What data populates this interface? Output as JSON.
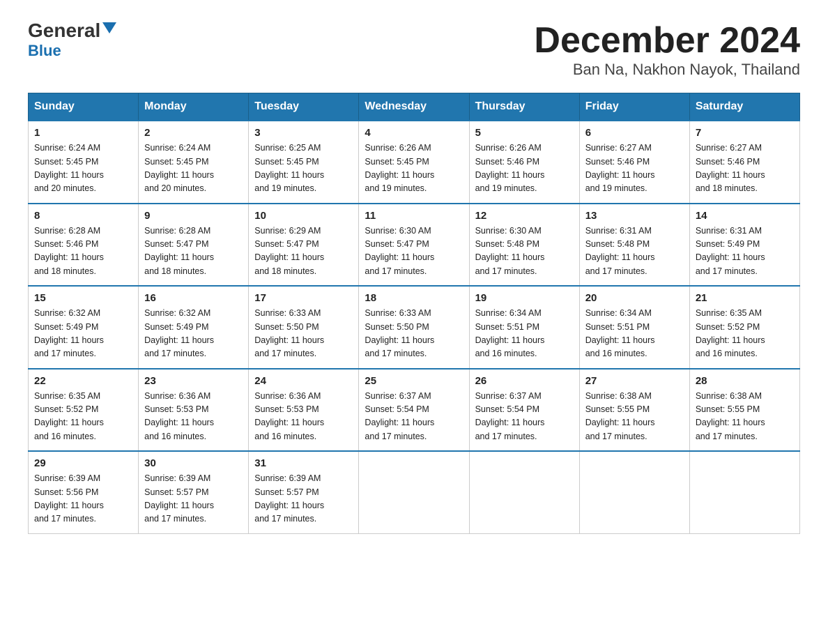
{
  "header": {
    "logo_general": "General",
    "logo_blue": "Blue",
    "month_title": "December 2024",
    "location": "Ban Na, Nakhon Nayok, Thailand"
  },
  "weekdays": [
    "Sunday",
    "Monday",
    "Tuesday",
    "Wednesday",
    "Thursday",
    "Friday",
    "Saturday"
  ],
  "weeks": [
    [
      {
        "day": "1",
        "sunrise": "6:24 AM",
        "sunset": "5:45 PM",
        "daylight": "11 hours and 20 minutes."
      },
      {
        "day": "2",
        "sunrise": "6:24 AM",
        "sunset": "5:45 PM",
        "daylight": "11 hours and 20 minutes."
      },
      {
        "day": "3",
        "sunrise": "6:25 AM",
        "sunset": "5:45 PM",
        "daylight": "11 hours and 19 minutes."
      },
      {
        "day": "4",
        "sunrise": "6:26 AM",
        "sunset": "5:45 PM",
        "daylight": "11 hours and 19 minutes."
      },
      {
        "day": "5",
        "sunrise": "6:26 AM",
        "sunset": "5:46 PM",
        "daylight": "11 hours and 19 minutes."
      },
      {
        "day": "6",
        "sunrise": "6:27 AM",
        "sunset": "5:46 PM",
        "daylight": "11 hours and 19 minutes."
      },
      {
        "day": "7",
        "sunrise": "6:27 AM",
        "sunset": "5:46 PM",
        "daylight": "11 hours and 18 minutes."
      }
    ],
    [
      {
        "day": "8",
        "sunrise": "6:28 AM",
        "sunset": "5:46 PM",
        "daylight": "11 hours and 18 minutes."
      },
      {
        "day": "9",
        "sunrise": "6:28 AM",
        "sunset": "5:47 PM",
        "daylight": "11 hours and 18 minutes."
      },
      {
        "day": "10",
        "sunrise": "6:29 AM",
        "sunset": "5:47 PM",
        "daylight": "11 hours and 18 minutes."
      },
      {
        "day": "11",
        "sunrise": "6:30 AM",
        "sunset": "5:47 PM",
        "daylight": "11 hours and 17 minutes."
      },
      {
        "day": "12",
        "sunrise": "6:30 AM",
        "sunset": "5:48 PM",
        "daylight": "11 hours and 17 minutes."
      },
      {
        "day": "13",
        "sunrise": "6:31 AM",
        "sunset": "5:48 PM",
        "daylight": "11 hours and 17 minutes."
      },
      {
        "day": "14",
        "sunrise": "6:31 AM",
        "sunset": "5:49 PM",
        "daylight": "11 hours and 17 minutes."
      }
    ],
    [
      {
        "day": "15",
        "sunrise": "6:32 AM",
        "sunset": "5:49 PM",
        "daylight": "11 hours and 17 minutes."
      },
      {
        "day": "16",
        "sunrise": "6:32 AM",
        "sunset": "5:49 PM",
        "daylight": "11 hours and 17 minutes."
      },
      {
        "day": "17",
        "sunrise": "6:33 AM",
        "sunset": "5:50 PM",
        "daylight": "11 hours and 17 minutes."
      },
      {
        "day": "18",
        "sunrise": "6:33 AM",
        "sunset": "5:50 PM",
        "daylight": "11 hours and 17 minutes."
      },
      {
        "day": "19",
        "sunrise": "6:34 AM",
        "sunset": "5:51 PM",
        "daylight": "11 hours and 16 minutes."
      },
      {
        "day": "20",
        "sunrise": "6:34 AM",
        "sunset": "5:51 PM",
        "daylight": "11 hours and 16 minutes."
      },
      {
        "day": "21",
        "sunrise": "6:35 AM",
        "sunset": "5:52 PM",
        "daylight": "11 hours and 16 minutes."
      }
    ],
    [
      {
        "day": "22",
        "sunrise": "6:35 AM",
        "sunset": "5:52 PM",
        "daylight": "11 hours and 16 minutes."
      },
      {
        "day": "23",
        "sunrise": "6:36 AM",
        "sunset": "5:53 PM",
        "daylight": "11 hours and 16 minutes."
      },
      {
        "day": "24",
        "sunrise": "6:36 AM",
        "sunset": "5:53 PM",
        "daylight": "11 hours and 16 minutes."
      },
      {
        "day": "25",
        "sunrise": "6:37 AM",
        "sunset": "5:54 PM",
        "daylight": "11 hours and 17 minutes."
      },
      {
        "day": "26",
        "sunrise": "6:37 AM",
        "sunset": "5:54 PM",
        "daylight": "11 hours and 17 minutes."
      },
      {
        "day": "27",
        "sunrise": "6:38 AM",
        "sunset": "5:55 PM",
        "daylight": "11 hours and 17 minutes."
      },
      {
        "day": "28",
        "sunrise": "6:38 AM",
        "sunset": "5:55 PM",
        "daylight": "11 hours and 17 minutes."
      }
    ],
    [
      {
        "day": "29",
        "sunrise": "6:39 AM",
        "sunset": "5:56 PM",
        "daylight": "11 hours and 17 minutes."
      },
      {
        "day": "30",
        "sunrise": "6:39 AM",
        "sunset": "5:57 PM",
        "daylight": "11 hours and 17 minutes."
      },
      {
        "day": "31",
        "sunrise": "6:39 AM",
        "sunset": "5:57 PM",
        "daylight": "11 hours and 17 minutes."
      },
      null,
      null,
      null,
      null
    ]
  ]
}
